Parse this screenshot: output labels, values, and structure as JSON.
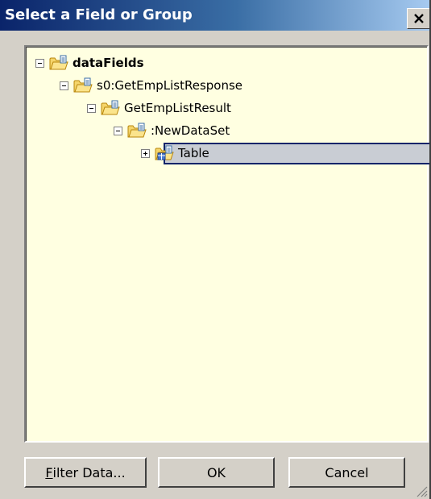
{
  "dialog": {
    "title": "Select a Field or Group",
    "close_glyph": "×"
  },
  "tree": {
    "nodes": [
      {
        "label": "dataFields",
        "expanded": true,
        "icon": "folder-data-icon"
      },
      {
        "label": "s0:GetEmpListResponse",
        "expanded": true,
        "icon": "folder-data-icon"
      },
      {
        "label": "GetEmpListResult",
        "expanded": true,
        "icon": "folder-data-icon"
      },
      {
        "label": ":NewDataSet",
        "expanded": true,
        "icon": "folder-data-icon"
      },
      {
        "label": "Table",
        "expanded": false,
        "selected": true,
        "icon": "folder-table-icon"
      }
    ]
  },
  "buttons": {
    "filter_accel": "F",
    "filter_rest": "ilter Data...",
    "ok": "OK",
    "cancel": "Cancel"
  },
  "colors": {
    "titlebar_start": "#0a246a",
    "titlebar_end": "#a6caf0",
    "tree_background": "#ffffe1",
    "selection": "#c9cdd4",
    "dialog_face": "#d4d0c8"
  }
}
